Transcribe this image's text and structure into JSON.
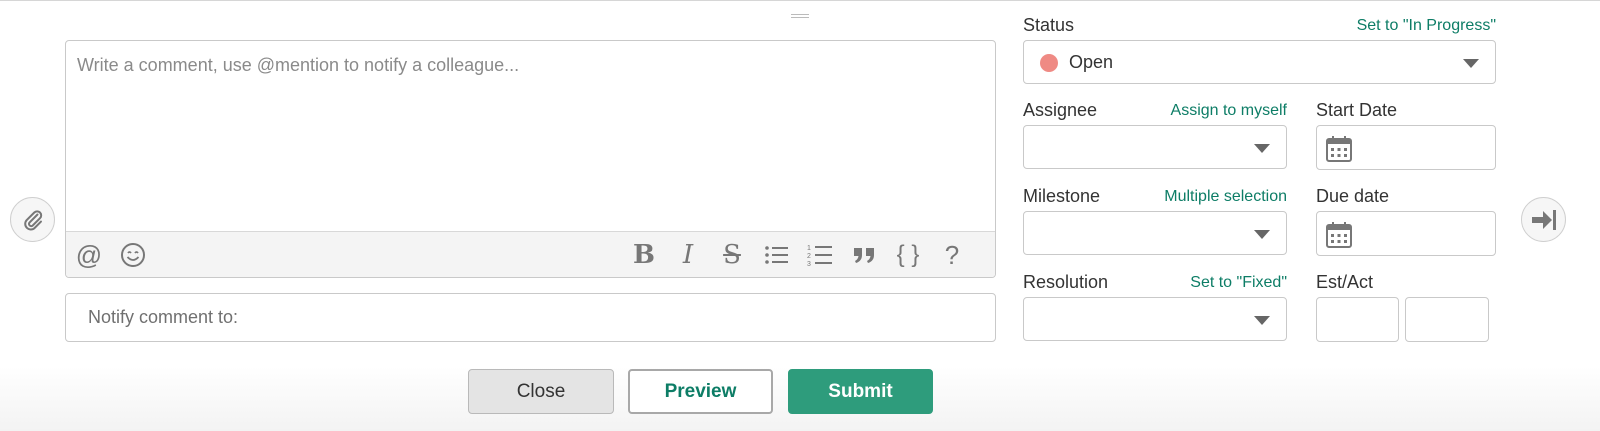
{
  "editor": {
    "placeholder": "Write a comment, use @mention to notify a colleague...",
    "toolbar": {
      "mention_icon": "@",
      "emoji_icon": "emoji-icon",
      "bold": "B",
      "italic": "I",
      "strike": "S",
      "code": "{ }",
      "help": "?"
    }
  },
  "notify": {
    "label": "Notify comment to:"
  },
  "buttons": {
    "close": "Close",
    "preview": "Preview",
    "submit": "Submit"
  },
  "status": {
    "label": "Status",
    "link": "Set to \"In Progress\"",
    "value": "Open",
    "dot_color": "#ef8a84"
  },
  "assignee": {
    "label": "Assignee",
    "link": "Assign to myself"
  },
  "milestone": {
    "label": "Milestone",
    "link": "Multiple selection"
  },
  "resolution": {
    "label": "Resolution",
    "link": "Set to \"Fixed\""
  },
  "start_date": {
    "label": "Start Date"
  },
  "due_date": {
    "label": "Due date"
  },
  "est_act": {
    "label": "Est/Act"
  },
  "colors": {
    "accent": "#0d7d66",
    "submit_bg": "#2e9c7c"
  }
}
